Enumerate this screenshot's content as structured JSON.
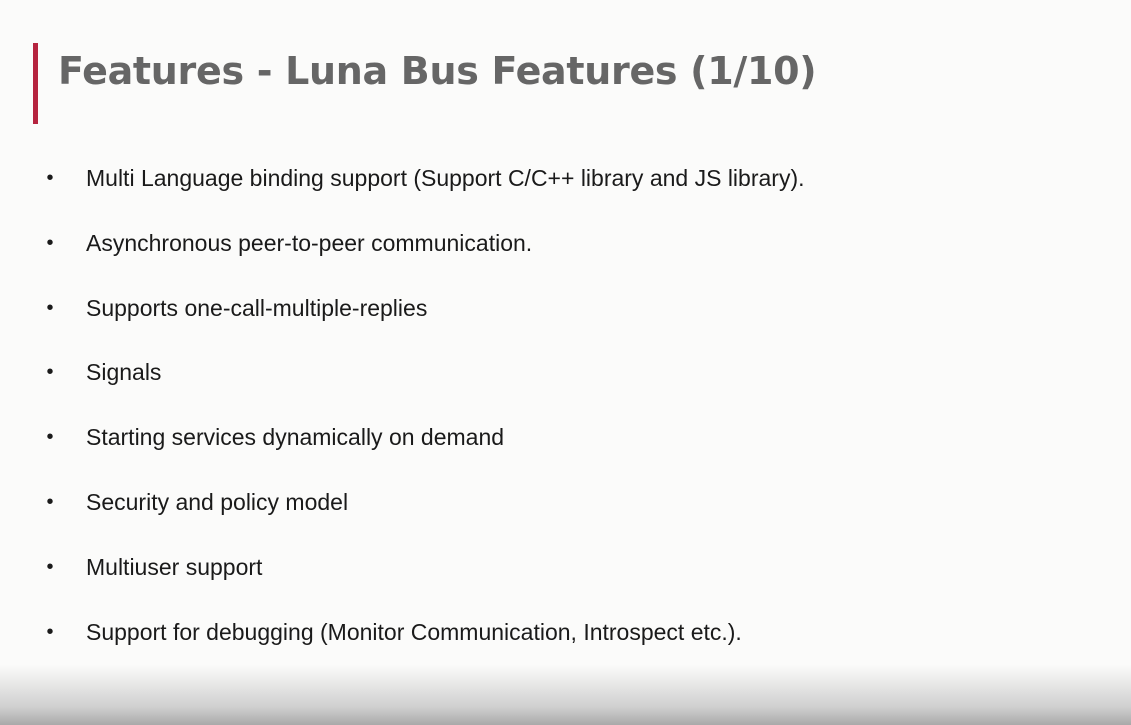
{
  "slide": {
    "title": "Features - Luna Bus Features (1/10)",
    "accent_color": "#b5243f",
    "bullet_symbol": "•",
    "bullets": [
      "Multi Language binding support (Support C/C++ library and JS library).",
      "Asynchronous peer-to-peer communication.",
      "Supports one-call-multiple-replies",
      "Signals",
      "Starting services dynamically on demand",
      "Security and policy model",
      "Multiuser support",
      "Support for debugging (Monitor Communication, Introspect etc.)."
    ]
  }
}
